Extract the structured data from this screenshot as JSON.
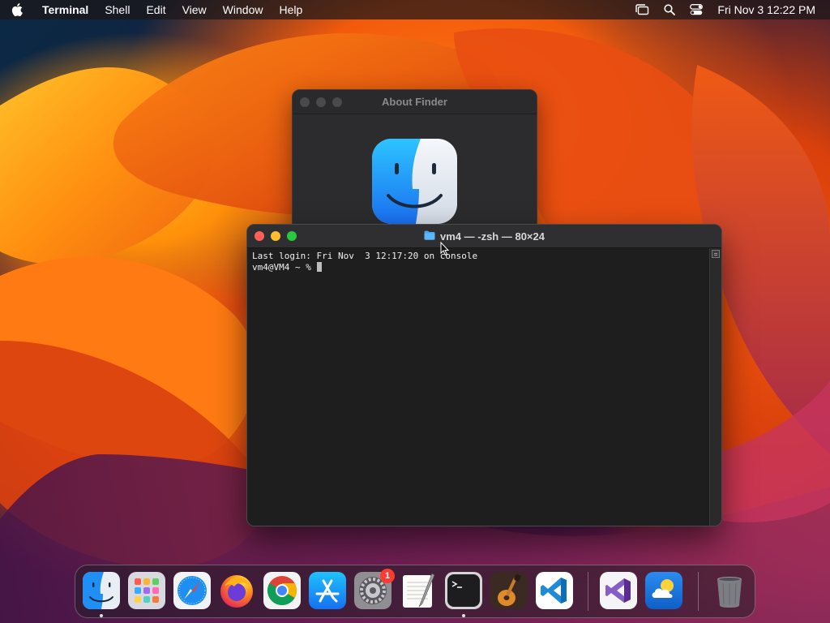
{
  "menubar": {
    "app_name": "Terminal",
    "menus": [
      "Shell",
      "Edit",
      "View",
      "Window",
      "Help"
    ],
    "clock": "Fri Nov 3  12:22 PM",
    "icons": [
      "apple-icon",
      "stage-manager-icon",
      "spotlight-search-icon",
      "control-center-icon"
    ]
  },
  "about_window": {
    "title": "About Finder",
    "icon": "finder-icon"
  },
  "terminal": {
    "title": "vm4 — -zsh — 80×24",
    "title_icon": "folder-icon",
    "lines": [
      "Last login: Fri Nov  3 12:17:20 on console",
      "vm4@VM4 ~ % "
    ]
  },
  "dock": {
    "items": [
      {
        "name": "finder",
        "running": true
      },
      {
        "name": "launchpad",
        "running": false
      },
      {
        "name": "safari",
        "running": false
      },
      {
        "name": "firefox",
        "running": false
      },
      {
        "name": "chrome",
        "running": false
      },
      {
        "name": "app-store",
        "running": false
      },
      {
        "name": "system-settings",
        "running": false,
        "badge": "1"
      },
      {
        "name": "textedit",
        "running": false
      },
      {
        "name": "terminal",
        "running": true
      },
      {
        "name": "garageband",
        "running": false
      },
      {
        "name": "vscode",
        "running": false
      },
      {
        "name": "visual-studio",
        "running": false
      },
      {
        "name": "weather",
        "running": false
      },
      {
        "name": "trash",
        "running": false
      }
    ]
  },
  "colors": {
    "traffic_red": "#ff5f57",
    "traffic_yellow": "#febc2e",
    "traffic_green": "#28c840",
    "badge": "#ff3b30"
  }
}
